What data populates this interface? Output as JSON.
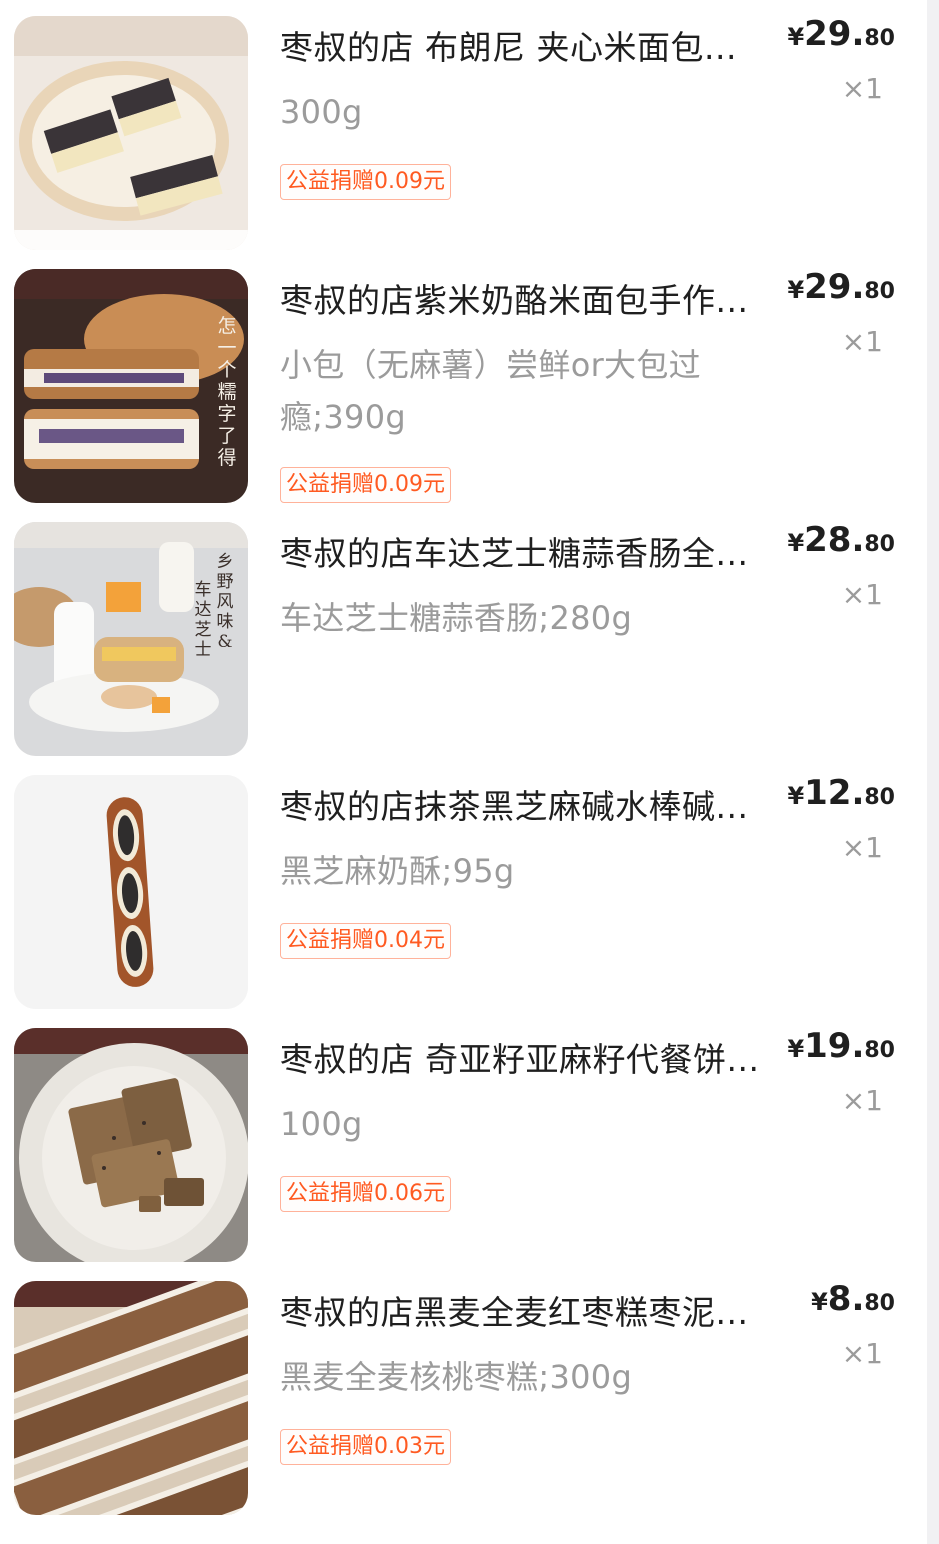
{
  "colors": {
    "title": "#1f1f1f",
    "spec": "#9b9b9b",
    "badge_text": "#ff5a21",
    "badge_border": "#ffb29a",
    "scrollbar_track": "#f1f1f3"
  },
  "items": [
    {
      "title": "枣叔的店 布朗尼 夹心米面包...",
      "spec": "300g",
      "badge": "公益捐赠0.09元",
      "price_symbol": "¥",
      "price_int": "29.",
      "price_dec": "80",
      "qty": "×1",
      "image": "brownie-sandwich-bread-photo"
    },
    {
      "title": "枣叔的店紫米奶酪米面包手作...",
      "spec": "小包（无麻薯）尝鲜or大包过瘾;390g",
      "badge": "公益捐赠0.09元",
      "price_symbol": "¥",
      "price_int": "29.",
      "price_dec": "80",
      "qty": "×1",
      "image": "purple-rice-cheese-bread-photo",
      "image_text": [
        "怎",
        "一",
        "个",
        "糯",
        "字",
        "了",
        "得"
      ]
    },
    {
      "title": "枣叔的店车达芝士糖蒜香肠全...",
      "spec": "车达芝士糖蒜香肠;280g",
      "price_symbol": "¥",
      "price_int": "28.",
      "price_dec": "80",
      "qty": "×1",
      "image": "cheddar-garlic-sausage-bread-photo",
      "image_text_a": [
        "乡",
        "野",
        "风",
        "味",
        "&"
      ],
      "image_text_b": [
        "车",
        "达",
        "芝",
        "士"
      ]
    },
    {
      "title": "枣叔的店抹茶黑芝麻碱水棒碱...",
      "spec": "黑芝麻奶酥;95g",
      "badge": "公益捐赠0.04元",
      "price_symbol": "¥",
      "price_int": "12.",
      "price_dec": "80",
      "qty": "×1",
      "image": "black-sesame-pretzel-stick-photo"
    },
    {
      "title": "枣叔的店 奇亚籽亚麻籽代餐饼...",
      "spec": "100g",
      "badge": "公益捐赠0.06元",
      "price_symbol": "¥",
      "price_int": "19.",
      "price_dec": "80",
      "qty": "×1",
      "image": "chia-flax-seed-crackers-photo"
    },
    {
      "title": "枣叔的店黑麦全麦红枣糕枣泥...",
      "spec": "黑麦全麦核桃枣糕;300g",
      "badge": "公益捐赠0.03元",
      "price_symbol": "¥",
      "price_int": "8.",
      "price_dec": "80",
      "qty": "×1",
      "image": "rye-walnut-date-cake-photo"
    }
  ]
}
